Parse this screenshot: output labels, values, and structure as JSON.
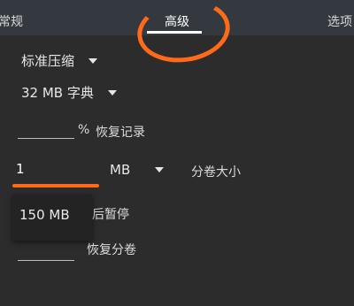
{
  "tabs": {
    "general": "常规",
    "advanced": "高级",
    "options": "选项"
  },
  "compression": {
    "value": "标准压缩"
  },
  "dictionary": {
    "value": "32 MB 字典"
  },
  "recovery": {
    "percent_symbol": "%",
    "label": "恢复记录"
  },
  "split": {
    "value": "1",
    "unit": "MB",
    "label": "分卷大小"
  },
  "popup": {
    "option": "150 MB"
  },
  "pause_after": {
    "label_visible": "后暂停"
  },
  "recovery_volumes": {
    "label": "恢复分卷"
  },
  "colors": {
    "annotation": "#ff6a1a",
    "focus_underline": "#7ddcd1",
    "background": "#2c2c2c"
  }
}
